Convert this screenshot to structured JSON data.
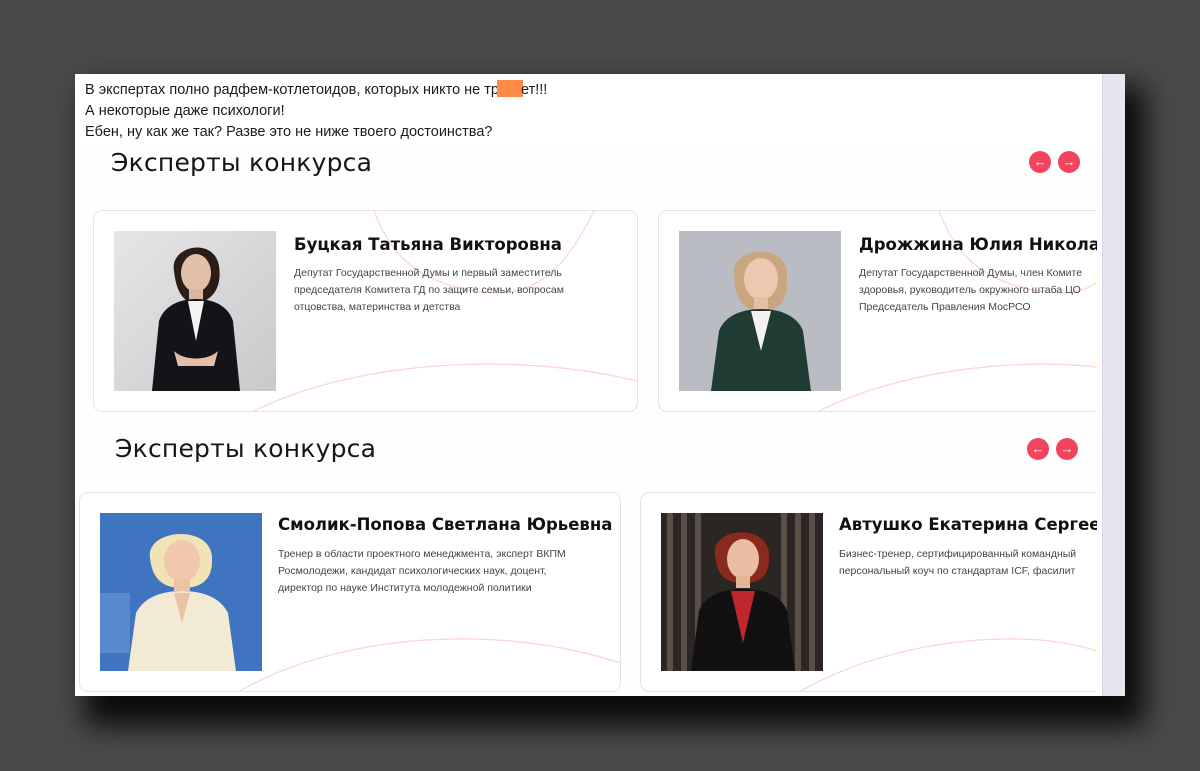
{
  "caption": {
    "line1_before": "В экспертах полно радфем-котлетоидов, которых никто не тр",
    "line1_after": "ет!!!",
    "line2": "А некоторые даже психологи!",
    "line3": "Ебен, ну как же так? Разве это не ниже твоего достоинства?"
  },
  "colors": {
    "accent": "#f0455d",
    "redaction": "#ff8a45"
  },
  "sections": [
    {
      "title": "Эксперты конкурса",
      "prev_icon": "arrow-left-icon",
      "next_icon": "arrow-right-icon",
      "prev_glyph": "←",
      "next_glyph": "→",
      "cards": [
        {
          "name": "Буцкая Татьяна Викторовна",
          "desc": [
            "Депутат Государственной Думы и первый заместитель",
            "председателя Комитета ГД по защите семьи, вопросам",
            "отцовства, материнства и детства"
          ]
        },
        {
          "name": "Дрожжина Юлия Николае",
          "desc": [
            "Депутат Государственной Думы, член Комите",
            "здоровья, руководитель окружного штаба ЦО",
            "Председатель Правления МосРСО"
          ]
        }
      ]
    },
    {
      "title": "Эксперты конкурса",
      "prev_icon": "arrow-left-icon",
      "next_icon": "arrow-right-icon",
      "prev_glyph": "←",
      "next_glyph": "→",
      "cards": [
        {
          "name": "Смолик-Попова Светлана Юрьевна",
          "desc": [
            "Тренер в области проектного менеджмента, эксперт ВКПМ",
            "Росмолодежи, кандидат психологических наук, доцент,",
            "директор по науке Института молодежной политики"
          ]
        },
        {
          "name": "Автушко Екатерина Сергеев",
          "desc": [
            "Бизнес-тренер, сертифицированный командный",
            "персональный коуч по стандартам ICF, фасилит"
          ]
        }
      ]
    }
  ]
}
